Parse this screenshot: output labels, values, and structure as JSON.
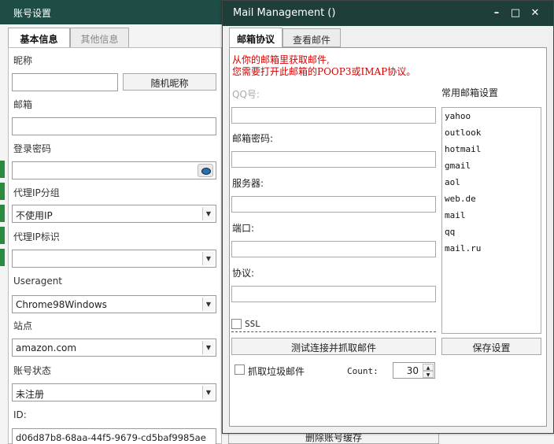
{
  "account_window": {
    "title": "账号设置",
    "tabs": [
      {
        "label": "基本信息",
        "active": true
      },
      {
        "label": "其他信息",
        "active": false
      }
    ],
    "fields": {
      "nickname_label": "昵称",
      "nickname_value": "",
      "random_nickname_button": "随机昵称",
      "email_label": "邮箱",
      "email_value": "",
      "password_label": "登录密码",
      "password_value": "",
      "proxy_group_label": "代理IP分组",
      "proxy_group_value": "不使用IP",
      "proxy_id_label": "代理IP标识",
      "proxy_id_value": "",
      "useragent_label": "Useragent",
      "useragent_value": "Chrome98Windows",
      "site_label": "站点",
      "site_value": "amazon.com",
      "status_label": "账号状态",
      "status_value": "未注册",
      "id_label": "ID:",
      "id_value": "d06d87b8-68aa-44f5-9679-cd5baf9985ae"
    },
    "delete_cache_button": "删除账号缓存",
    "accent_color": "#1e4d45",
    "edge_green": "#1f8f3a"
  },
  "mail_window": {
    "title": "Mail Management ()",
    "controls": {
      "minimize": "–",
      "maximize": "□",
      "close": "✕"
    },
    "tabs": [
      {
        "label": "邮箱协议",
        "active": true
      },
      {
        "label": "查看邮件",
        "active": false
      }
    ],
    "note_line1": "从你的邮箱里获取邮件,",
    "note_line2": "您需要打开此邮箱的POOP3或IMAP协议。",
    "note_color": "#d40000",
    "qq_label": "QQ号:",
    "qq_value": "",
    "password_label": "邮箱密码:",
    "password_value": "",
    "server_label": "服务器:",
    "server_value": "",
    "port_label": "端口:",
    "port_value": "",
    "protocol_label": "协议:",
    "protocol_value": "",
    "ssl_label": "SSL",
    "ssl_checked": false,
    "test_button": "测试连接并抓取邮件",
    "junk_label": "抓取垃圾邮件",
    "junk_checked": false,
    "count_label": "Count:",
    "count_value": "30",
    "presets_label": "常用邮箱设置",
    "presets": [
      "yahoo",
      "outlook",
      "hotmail",
      "gmail",
      "aol",
      "web.de",
      "mail",
      "qq",
      "mail.ru"
    ],
    "save_button": "保存设置",
    "titlebar_color": "#1e3f39"
  }
}
